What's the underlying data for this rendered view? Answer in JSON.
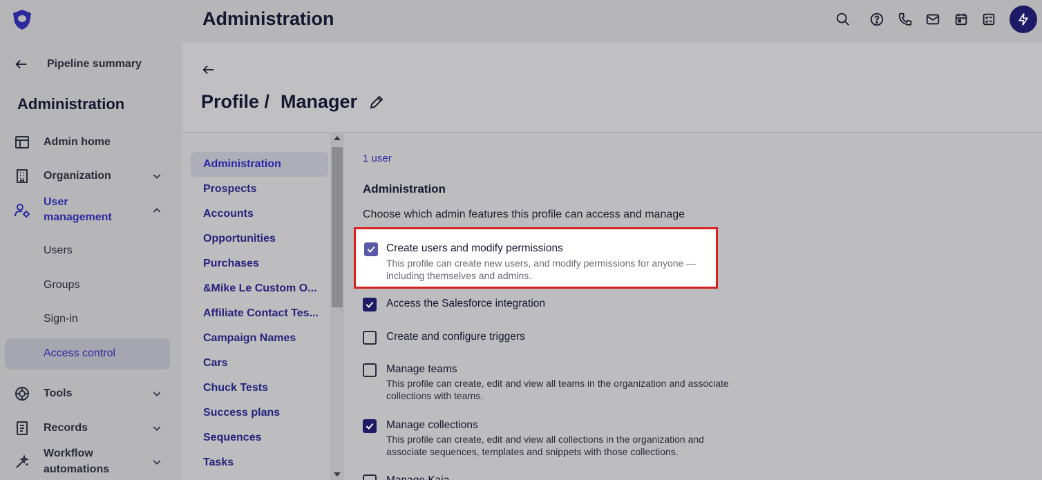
{
  "header": {
    "title": "Administration",
    "icons": [
      "search-icon",
      "help-icon",
      "phone-icon",
      "mail-icon",
      "calendar-icon",
      "tasks-icon",
      "bolt-icon"
    ]
  },
  "leftnav": {
    "back_label": "Pipeline summary",
    "heading": "Administration",
    "items": [
      {
        "label": "Admin home",
        "icon": "layout-icon"
      },
      {
        "label": "Organization",
        "icon": "building-icon"
      },
      {
        "label": "User",
        "label2": "management",
        "icon": "user-gear-icon"
      },
      {
        "label": "Tools",
        "icon": "tools-icon"
      },
      {
        "label": "Records",
        "icon": "records-icon"
      },
      {
        "label": "Workflow",
        "label2": "automations",
        "icon": "wand-icon"
      }
    ],
    "subitems": [
      "Users",
      "Groups",
      "Sign-in",
      "Access control"
    ]
  },
  "page": {
    "title_part1": "Profile /",
    "title_part2": "Manager"
  },
  "subnav": {
    "items": [
      "Administration",
      "Prospects",
      "Accounts",
      "Opportunities",
      "Purchases",
      "&Mike Le Custom O...",
      "Affiliate Contact Tes...",
      "Campaign Names",
      "Cars",
      "Chuck Tests",
      "Success plans",
      "Sequences",
      "Tasks"
    ]
  },
  "content": {
    "users_link": "1 user",
    "section_title": "Administration",
    "section_desc": "Choose which admin features this profile can access and manage",
    "permissions": [
      {
        "title": "Create users and modify permissions",
        "desc": "This profile can create new users, and modify permissions for anyone — including themselves and admins.",
        "checked": true
      },
      {
        "title": "Access the Salesforce integration",
        "desc": "",
        "checked": true
      },
      {
        "title": "Create and configure triggers",
        "desc": "",
        "checked": false
      },
      {
        "title": "Manage teams",
        "desc": "This profile can create, edit and view all teams in the organization and associate collections with teams.",
        "checked": false
      },
      {
        "title": "Manage collections",
        "desc": "This profile can create, edit and view all collections in the organization and associate sequences, templates and snippets with those collections.",
        "checked": true
      },
      {
        "title": "Manage Kaia",
        "desc": "",
        "checked": false
      }
    ]
  },
  "colors": {
    "accent": "#1e1a66",
    "link": "#2c2aa0",
    "highlight_border": "#d6221f"
  }
}
